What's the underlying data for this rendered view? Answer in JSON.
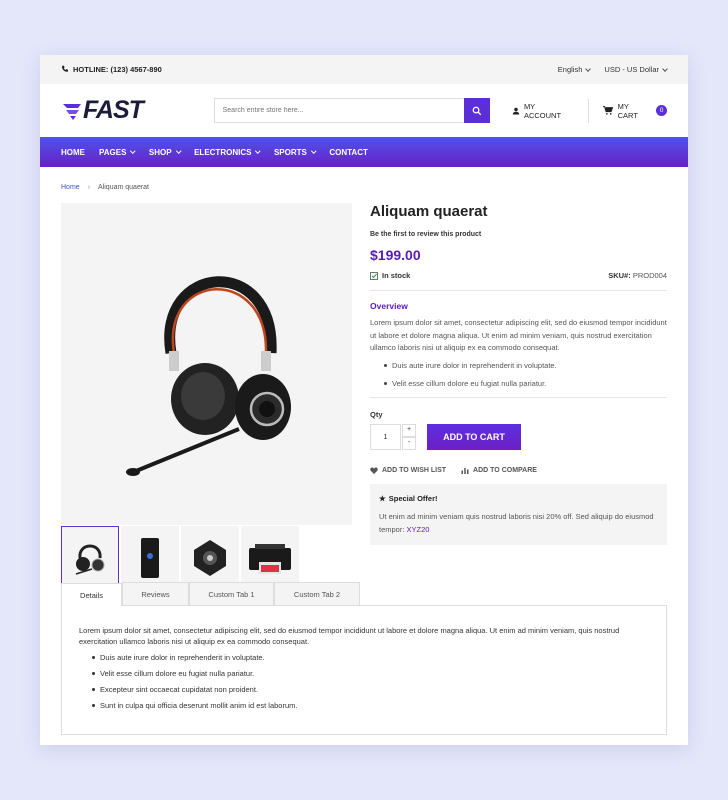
{
  "topbar": {
    "hotline": "HOTLINE: (123) 4567-890",
    "language": "English",
    "currency": "USD - US Dollar"
  },
  "header": {
    "logo": "FAST",
    "search_placeholder": "Search entire store here...",
    "account_label": "MY ACCOUNT",
    "cart_label": "MY CART",
    "cart_count": "0",
    "accent_color": "#5b2fd6"
  },
  "nav": {
    "items": [
      {
        "label": "HOME",
        "dropdown": false
      },
      {
        "label": "PAGES",
        "dropdown": true
      },
      {
        "label": "SHOP",
        "dropdown": true
      },
      {
        "label": "ELECTRONICS",
        "dropdown": true
      },
      {
        "label": "SPORTS",
        "dropdown": true
      },
      {
        "label": "CONTACT",
        "dropdown": false
      }
    ]
  },
  "breadcrumb": {
    "home": "Home",
    "current": "Aliquam quaerat"
  },
  "product": {
    "title": "Aliquam quaerat",
    "review_link": "Be the first to review this product",
    "price": "$199.00",
    "stock": "In stock",
    "sku_label": "SKU#:",
    "sku_value": "PROD004",
    "overview_heading": "Overview",
    "overview_text": "Lorem ipsum dolor sit amet, consectetur adipiscing elit, sed do eiusmod tempor incididunt ut labore et dolore magna aliqua. Ut enim ad minim veniam, quis nostrud exercitation ullamco laboris nisi ut aliquip ex ea commodo consequat.",
    "overview_list": [
      "Duis aute irure dolor in reprehenderit in voluptate.",
      "Velit esse cillum dolore eu fugiat nulla pariatur."
    ],
    "qty_label": "Qty",
    "qty_value": "1",
    "qty_plus": "+",
    "qty_minus": "-",
    "add_to_cart": "ADD TO CART",
    "wishlist": "ADD TO WISH LIST",
    "compare": "ADD TO COMPARE",
    "offer_title": "Special Offer!",
    "offer_text": "Ut enim ad minim veniam quis nostrud laboris nisi 20% off. Sed aliquip do eiusmod tempor:",
    "offer_code": "XYZ20"
  },
  "gallery": {
    "thumbs": [
      "headset",
      "router",
      "speaker",
      "printer"
    ],
    "active_index": 0
  },
  "tabs": {
    "items": [
      "Details",
      "Reviews",
      "Custom Tab 1",
      "Custom Tab 2"
    ],
    "active": "Details",
    "details_text": "Lorem ipsum dolor sit amet, consectetur adipiscing elit, sed do eiusmod tempor incididunt ut labore et dolore magna aliqua. Ut enim ad minim veniam, quis nostrud exercitation ullamco laboris nisi ut aliquip ex ea commodo consequat.",
    "details_list": [
      "Duis aute irure dolor in reprehenderit in voluptate.",
      "Velit esse cillum dolore eu fugiat nulla pariatur.",
      "Excepteur sint occaecat cupidatat non proident.",
      "Sunt in culpa qui officia deserunt mollit anim id est laborum."
    ]
  }
}
